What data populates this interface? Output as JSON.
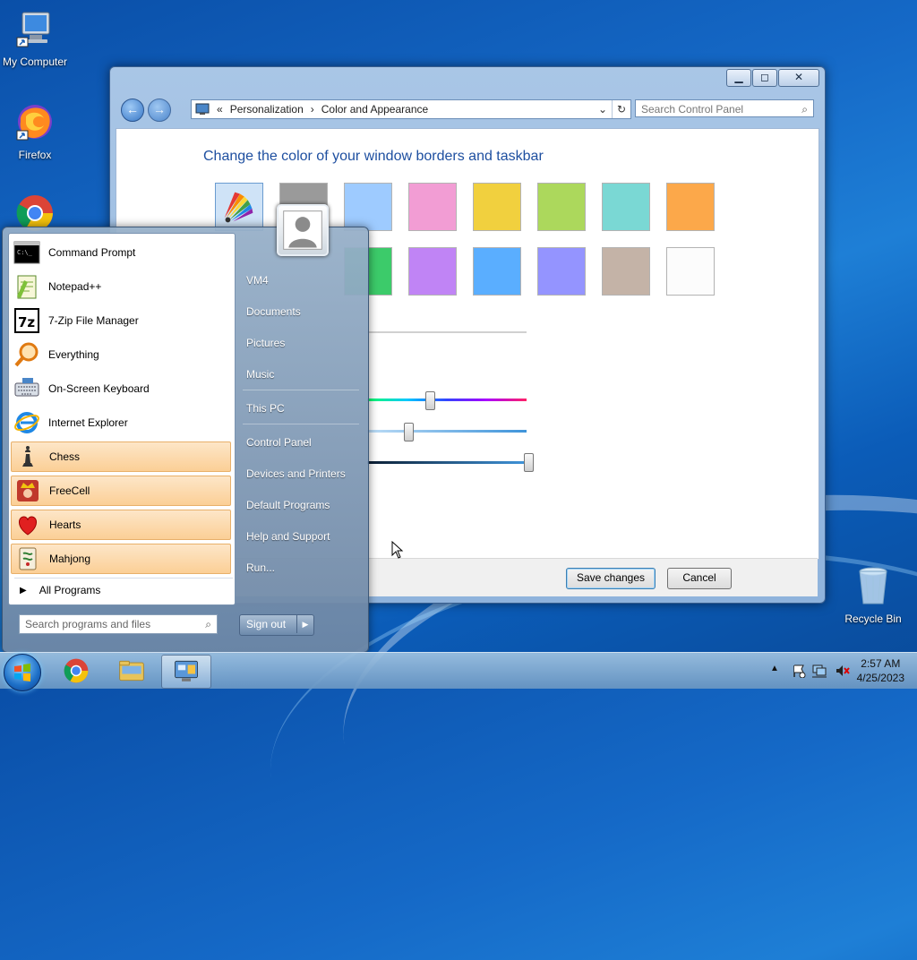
{
  "desktop": {
    "icons": [
      {
        "label": "My Computer"
      },
      {
        "label": "Firefox"
      },
      {
        "label": "Recycle Bin"
      }
    ]
  },
  "window": {
    "controls": {
      "minimize": "▁",
      "maximize": "◻",
      "close": "✕"
    },
    "nav": {
      "back": "←",
      "forward": "→"
    },
    "address": {
      "chevrons": "«",
      "crumb1": "Personalization",
      "crumb2": "Color and Appearance",
      "arrow": "›"
    },
    "search_placeholder": "Search Control Panel",
    "title": "Change the color of your window borders and taskbar",
    "swatch_colors_row1": [
      "#ffffff",
      "#9a9a9a",
      "#9ecbff",
      "#f29dd4",
      "#f1d03e",
      "#acd85c",
      "#7ad8d4",
      "#fca84a"
    ],
    "swatch_colors_row2": [
      "#d9646f",
      "#a04a91",
      "#3ccb6a",
      "#c084f5",
      "#5aaeff",
      "#9494ff",
      "#c4b3a7",
      "#fcfcfc"
    ],
    "save_label": "Save changes",
    "cancel_label": "Cancel"
  },
  "start_menu": {
    "programs": [
      {
        "label": "Command Prompt"
      },
      {
        "label": "Notepad++"
      },
      {
        "label": "7-Zip File Manager"
      },
      {
        "label": "Everything"
      },
      {
        "label": "On-Screen Keyboard"
      },
      {
        "label": "Internet Explorer"
      },
      {
        "label": "Chess"
      },
      {
        "label": "FreeCell"
      },
      {
        "label": "Hearts"
      },
      {
        "label": "Mahjong"
      }
    ],
    "all_programs": "All Programs",
    "search_placeholder": "Search programs and files",
    "right_items": [
      "VM4",
      "Documents",
      "Pictures",
      "Music",
      "This PC",
      "Control Panel",
      "Devices and Printers",
      "Default Programs",
      "Help and Support",
      "Run..."
    ],
    "sign_out": "Sign out"
  },
  "taskbar": {
    "clock_time": "2:57 AM",
    "clock_date": "4/25/2023"
  }
}
